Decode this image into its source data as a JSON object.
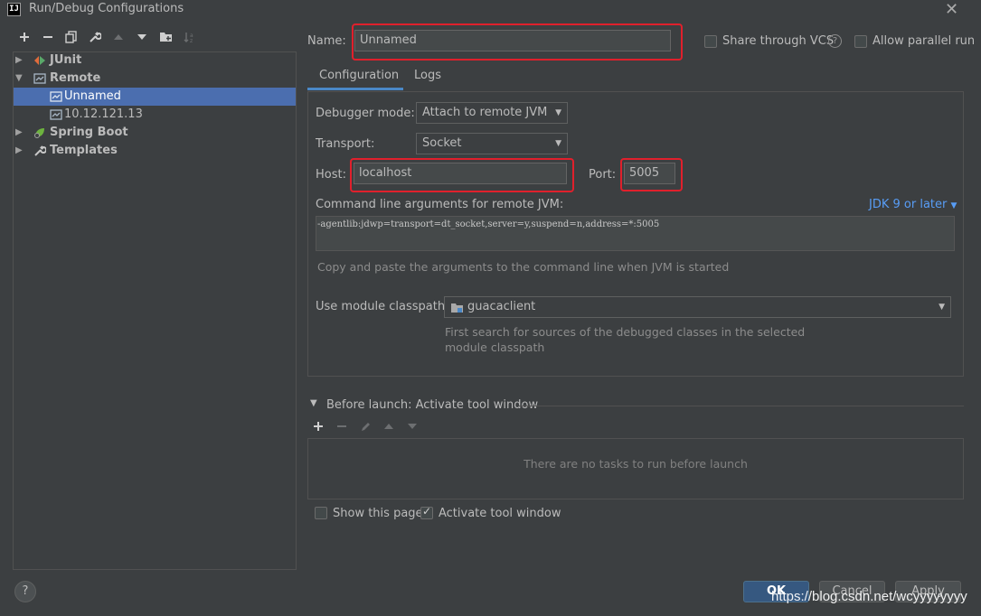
{
  "window": {
    "title": "Run/Debug Configurations",
    "app_icon_text": "IJ"
  },
  "toolbar": {
    "icons": [
      "add-icon",
      "remove-icon",
      "copy-icon",
      "wrench-icon",
      "move-up-icon",
      "move-down-icon",
      "folder-icon",
      "sort-icon"
    ]
  },
  "tree": {
    "items": [
      {
        "label": "JUnit",
        "icon": "junit-icon",
        "expanded": false,
        "level": 0
      },
      {
        "label": "Remote",
        "icon": "remote-icon",
        "expanded": true,
        "level": 0
      },
      {
        "label": "Unnamed",
        "icon": "remote-config-icon",
        "level": 1,
        "selected": true
      },
      {
        "label": "10.12.121.13",
        "icon": "remote-config-icon",
        "level": 1
      },
      {
        "label": "Spring Boot",
        "icon": "spring-boot-icon",
        "expanded": false,
        "level": 0
      },
      {
        "label": "Templates",
        "icon": "wrench-icon",
        "expanded": false,
        "level": 0
      }
    ]
  },
  "form": {
    "name_label": "Name:",
    "name_value": "Unnamed",
    "share_vcs_label": "Share through VCS",
    "allow_parallel_label": "Allow parallel run",
    "tabs": [
      "Configuration",
      "Logs"
    ],
    "debugger_mode_label": "Debugger mode:",
    "debugger_mode_value": "Attach to remote JVM",
    "transport_label": "Transport:",
    "transport_value": "Socket",
    "host_label": "Host:",
    "host_value": "localhost",
    "port_label": "Port:",
    "port_value": "5005",
    "cmd_args_label": "Command line arguments for remote JVM:",
    "jdk_link": "JDK 9 or later",
    "cmd_args_value": "-agentlib:jdwp=transport=dt_socket,server=y,suspend=n,address=*:5005",
    "cmd_args_hint": "Copy and paste the arguments to the command line when JVM is started",
    "module_classpath_label": "Use module classpath:",
    "module_classpath_value": "guacaclient",
    "module_hint_line1": "First search for sources of the debugged classes in the selected",
    "module_hint_line2": "module classpath",
    "before_launch_label": "Before launch: Activate tool window",
    "no_tasks_text": "There are no tasks to run before launch",
    "show_page_label": "Show this page",
    "activate_tool_label": "Activate tool window"
  },
  "buttons": {
    "ok": "OK",
    "cancel": "Cancel",
    "apply": "Apply",
    "help": "?"
  },
  "watermark": "https://blog.csdn.net/wcyyyyyyyy",
  "colors": {
    "accent": "#4b6eaf",
    "highlight": "#e0202c",
    "link": "#589df6",
    "background": "#3c3f41"
  }
}
